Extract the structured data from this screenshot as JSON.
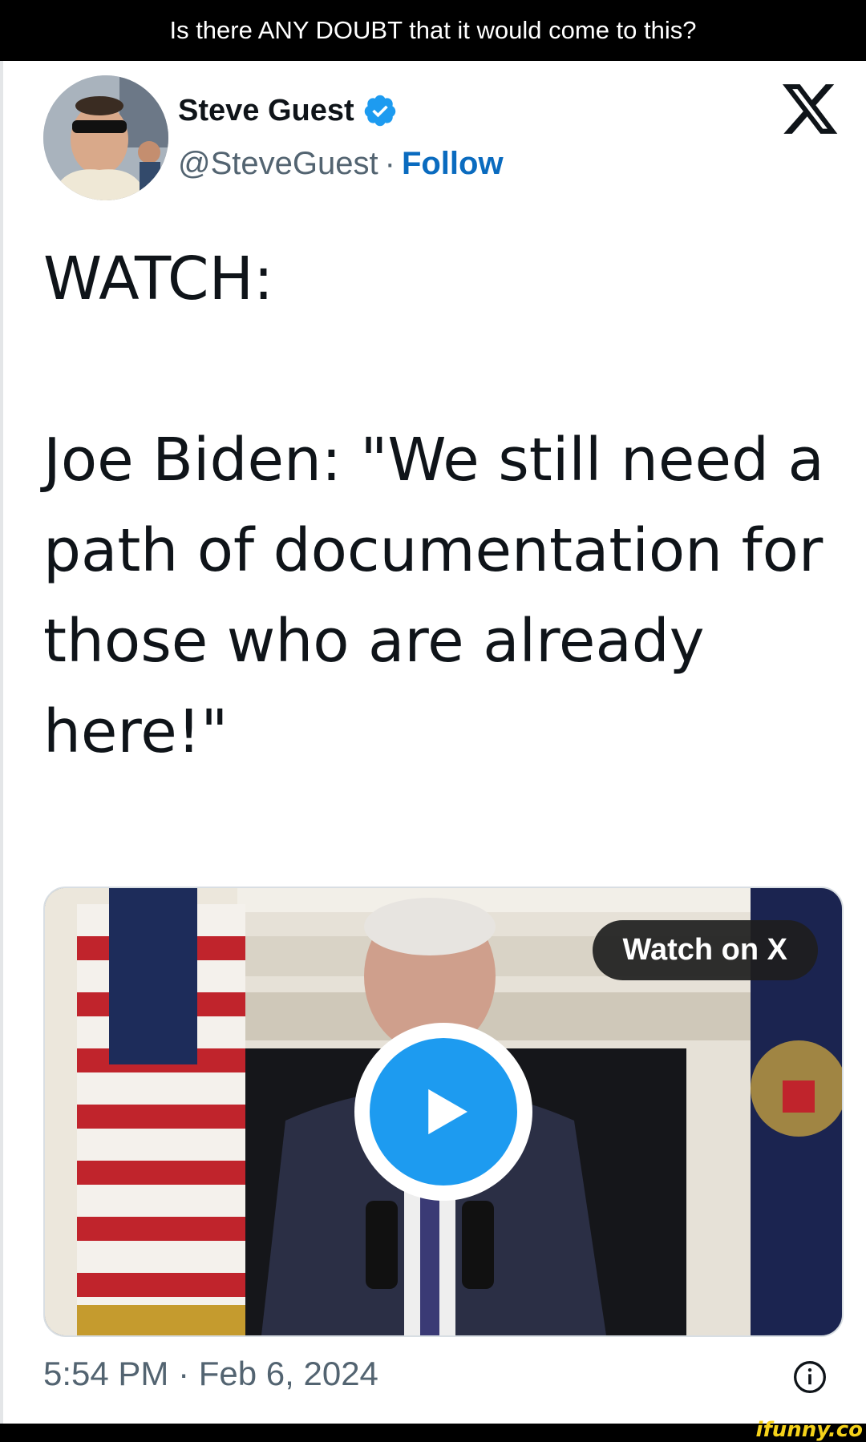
{
  "caption": "Is there ANY DOUBT that it would come to this?",
  "tweet": {
    "author": {
      "name": "Steve Guest",
      "handle": "@SteveGuest",
      "separator": "·",
      "follow_label": "Follow",
      "verified": true
    },
    "text": "WATCH:\n\nJoe Biden: \"We still need a path of documentation for those who are already here!\"",
    "media": {
      "watch_label": "Watch on X",
      "play_icon": "play-icon"
    },
    "timestamp": "5:54 PM · Feb 6, 2024"
  },
  "watermark": "ifunny.co",
  "colors": {
    "accent_blue": "#1d9bf0",
    "follow_blue": "#0a6bbf",
    "text_primary": "#0f1419",
    "text_secondary": "#536471"
  }
}
